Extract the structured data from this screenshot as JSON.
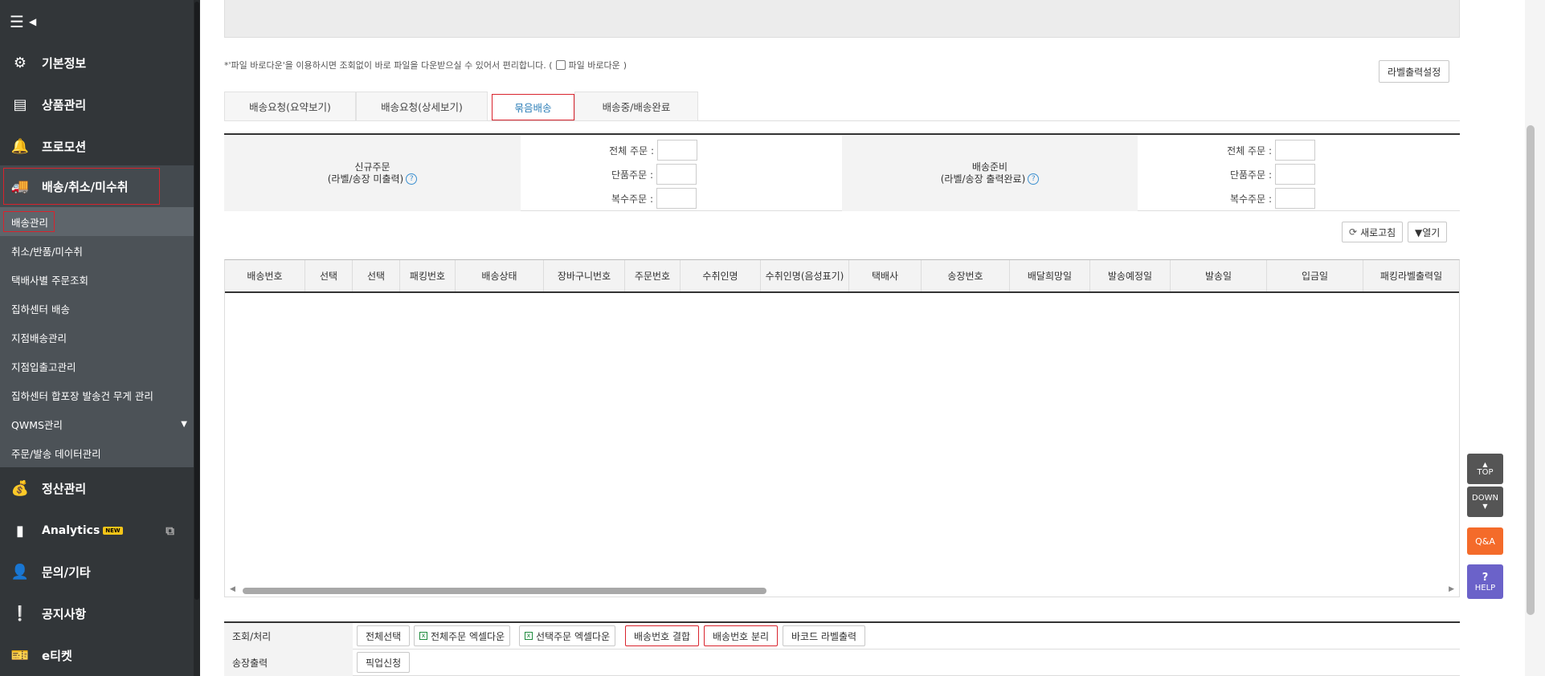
{
  "sidebar": {
    "menus": [
      {
        "label": "기본정보",
        "icon": "gears-icon",
        "glyph": "⚙"
      },
      {
        "label": "상품관리",
        "icon": "document-icon",
        "glyph": "▤"
      },
      {
        "label": "프로모션",
        "icon": "bell-icon",
        "glyph": "🔔"
      },
      {
        "label": "배송/취소/미수취",
        "icon": "truck-icon",
        "glyph": "🚚"
      },
      {
        "label": "정산관리",
        "icon": "money-bag-icon",
        "glyph": "💰"
      },
      {
        "label": "Analytics",
        "icon": "bar-chart-icon",
        "glyph": "▮"
      },
      {
        "label": "문의/기타",
        "icon": "person-icon",
        "glyph": "👤"
      },
      {
        "label": "공지사항",
        "icon": "notice-icon",
        "glyph": "❕"
      },
      {
        "label": "e티켓",
        "icon": "ticket-icon",
        "glyph": "🎫"
      }
    ],
    "analytics_badge": "NEW",
    "submenu": [
      "배송관리",
      "취소/반품/미수취",
      "택배사별 주문조회",
      "집하센터 배송",
      "지점배송관리",
      "지점입출고관리",
      "집하센터 합포장 발송건 무게 관리",
      "QWMS관리",
      "주문/발송 데이터관리"
    ]
  },
  "notice": {
    "text": "*'파일 바로다운'을 이용하시면 조회없이 바로 파일을 다운받으실 수 있어서 편리합니다. (",
    "checkbox_label": "파일 바로다운",
    "close": ")"
  },
  "label_settings_button": "라벨출력설정",
  "tabs": [
    "배송요청(요약보기)",
    "배송요청(상세보기)",
    "묶음배송",
    "배송중/배송완료"
  ],
  "summary": {
    "left": {
      "title": "신규주문",
      "subtitle": "(라벨/송장 미출력)",
      "rows": [
        {
          "label": "전체 주문 :",
          "value": ""
        },
        {
          "label": "단품주문 :",
          "value": ""
        },
        {
          "label": "복수주문 :",
          "value": ""
        }
      ]
    },
    "right": {
      "title": "배송준비",
      "subtitle": "(라벨/송장 출력완료)",
      "rows": [
        {
          "label": "전체 주문 :",
          "value": ""
        },
        {
          "label": "단품주문 :",
          "value": ""
        },
        {
          "label": "복수주문 :",
          "value": ""
        }
      ]
    },
    "help": "?"
  },
  "grid_tools": {
    "refresh": "새로고침",
    "open": "▼열기"
  },
  "columns": [
    "배송번호",
    "선택",
    "선택",
    "패킹번호",
    "배송상태",
    "장바구니번호",
    "주문번호",
    "수취인명",
    "수취인명(음성표기)",
    "택배사",
    "송장번호",
    "배달희망일",
    "발송예정일",
    "발송일",
    "입금일",
    "패킹라벨출력일"
  ],
  "actions": {
    "row1_title": "조회/처리",
    "row1_buttons": [
      "전체선택",
      "전체주문 엑셀다운",
      "선택주문 엑셀다운",
      "배송번호 결합",
      "배송번호 분리",
      "바코드 라벨출력"
    ],
    "row2_title": "송장출력",
    "row2_buttons": [
      "픽업신청"
    ]
  },
  "floating": {
    "top": "TOP",
    "down": "DOWN",
    "qa": "Q&A",
    "help": "HELP"
  }
}
